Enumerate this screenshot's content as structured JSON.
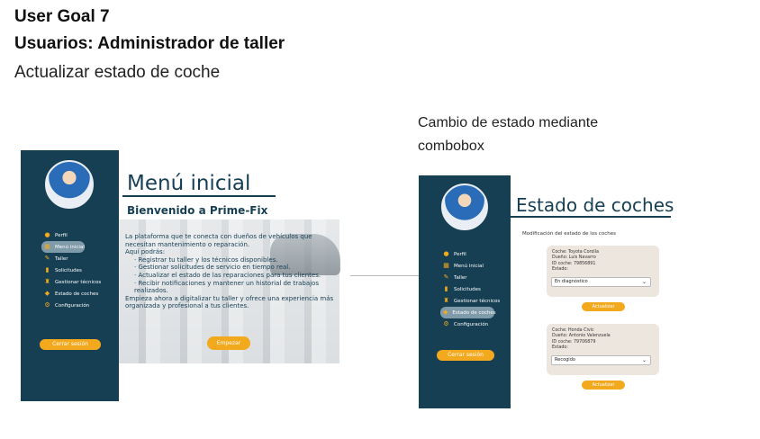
{
  "header": {
    "goal": "User Goal 7",
    "users": "Usuarios: Administrador de taller",
    "task": "Actualizar estado de coche"
  },
  "annotation": {
    "line1": "Cambio de estado mediante",
    "line2": "combobox"
  },
  "colors": {
    "sidebar": "#163f54",
    "accent": "#f2a91e",
    "active_item": "#7f9aa8"
  },
  "nav_items": [
    {
      "label": "Perfil",
      "icon": "user-icon"
    },
    {
      "label": "Menú inicial",
      "icon": "grid-icon"
    },
    {
      "label": "Taller",
      "icon": "wrench-icon"
    },
    {
      "label": "Solicitudes",
      "icon": "clipboard-icon"
    },
    {
      "label": "Gestionar técnicos",
      "icon": "technicians-icon"
    },
    {
      "label": "Estado de coches",
      "icon": "diamond-icon"
    },
    {
      "label": "Configuración",
      "icon": "gear-icon"
    }
  ],
  "logout_label": "Cerrar sesión",
  "screen1": {
    "title": "Menú inicial",
    "subtitle": "Bienvenido a Prime-Fix",
    "intro": "La plataforma que te conecta con dueños de vehículos que necesitan mantenimiento o reparación.",
    "here": "Aquí podrás:",
    "bullets": [
      "Registrar tu taller y los técnicos disponibles.",
      "Gestionar solicitudes de servicio en tiempo real.",
      "Actualizar el estado de las reparaciones para tus clientes.",
      "Recibir notificaciones y mantener un historial de trabajos realizados."
    ],
    "outro": "Empieza ahora a digitalizar tu taller y ofrece una experiencia más organizada y profesional a tus clientes.",
    "start_button": "Empezar"
  },
  "screen2": {
    "title": "Estado de coches",
    "subtitle": "Modificación del estado de los coches",
    "cards": [
      {
        "car": "Coche: Toyota Corolla",
        "owner": "Dueño: Luis Navarro",
        "vehicle_id": "ID coche: 79856891",
        "state_label": "Estado:",
        "state_value": "En diagnóstico",
        "update_button": "Actualizar"
      },
      {
        "car": "Coche: Honda Civic",
        "owner": "Dueño: Antonio Valenzuela",
        "vehicle_id": "ID coche: 79706879",
        "state_label": "Estado:",
        "state_value": "Recogido",
        "update_button": "Actualizar"
      }
    ]
  }
}
